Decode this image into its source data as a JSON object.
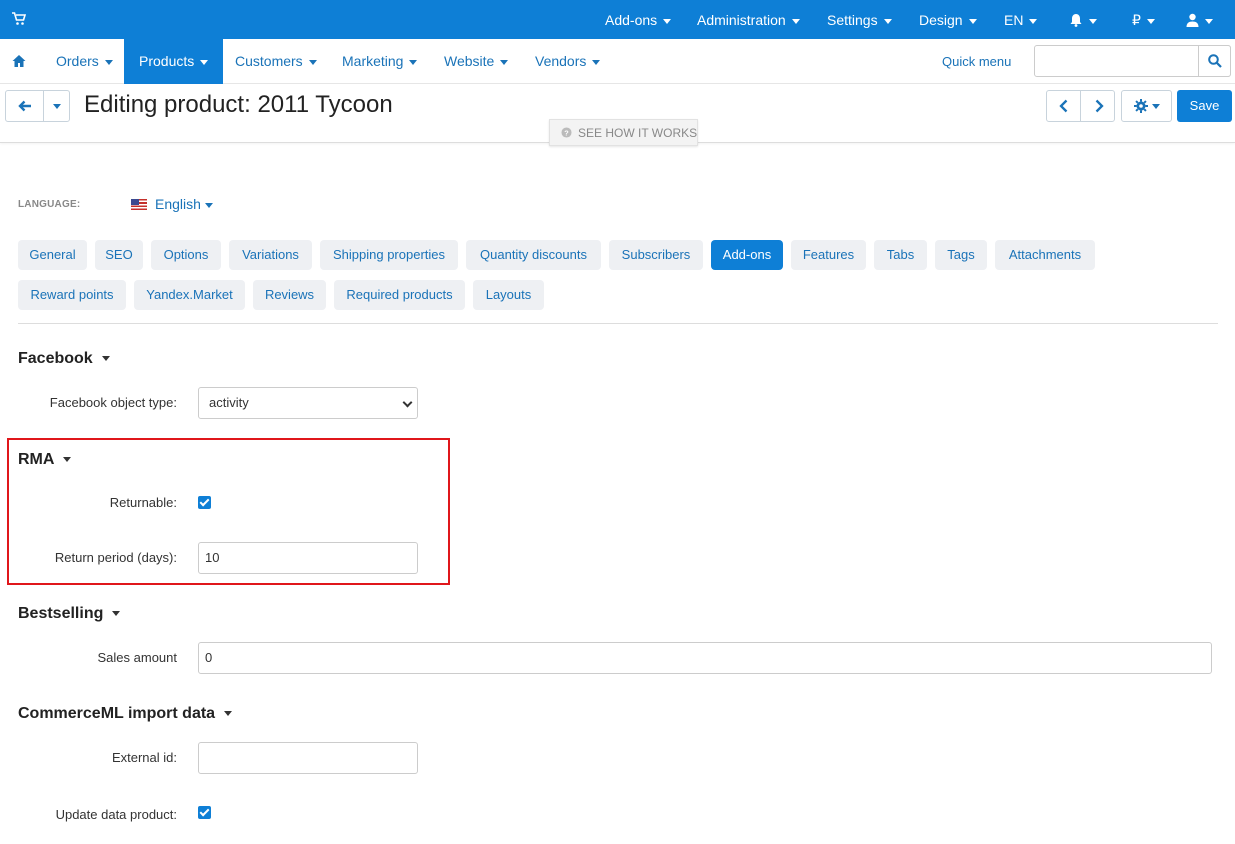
{
  "topbar": {
    "items": [
      "Add-ons",
      "Administration",
      "Settings",
      "Design",
      "EN"
    ],
    "currency": "₽"
  },
  "nav": {
    "items": [
      "Orders",
      "Products",
      "Customers",
      "Marketing",
      "Website",
      "Vendors"
    ],
    "active": "Products",
    "quick_menu": "Quick menu",
    "search_placeholder": ""
  },
  "header": {
    "title": "Editing product: 2011 Tycoon",
    "how_it_works": "SEE HOW IT WORKS",
    "save": "Save"
  },
  "language": {
    "label": "LANGUAGE:",
    "value": "English"
  },
  "tabs": [
    "General",
    "SEO",
    "Options",
    "Variations",
    "Shipping properties",
    "Quantity discounts",
    "Subscribers",
    "Add-ons",
    "Features",
    "Tabs",
    "Tags",
    "Attachments",
    "Reward points",
    "Yandex.Market",
    "Reviews",
    "Required products",
    "Layouts"
  ],
  "active_tab": "Add-ons",
  "sections": {
    "facebook": {
      "title": "Facebook",
      "object_type_label": "Facebook object type:",
      "object_type_value": "activity"
    },
    "rma": {
      "title": "RMA",
      "returnable_label": "Returnable:",
      "returnable": true,
      "return_period_label": "Return period (days):",
      "return_period_value": "10"
    },
    "bestselling": {
      "title": "Bestselling",
      "sales_amount_label": "Sales amount",
      "sales_amount_value": "0"
    },
    "commerceml": {
      "title": "CommerceML import data",
      "external_id_label": "External id:",
      "external_id_value": "",
      "update_data_label": "Update data product:",
      "update_data": true
    }
  },
  "colors": {
    "primary": "#0e7fd6",
    "highlight": "#e0161b"
  }
}
